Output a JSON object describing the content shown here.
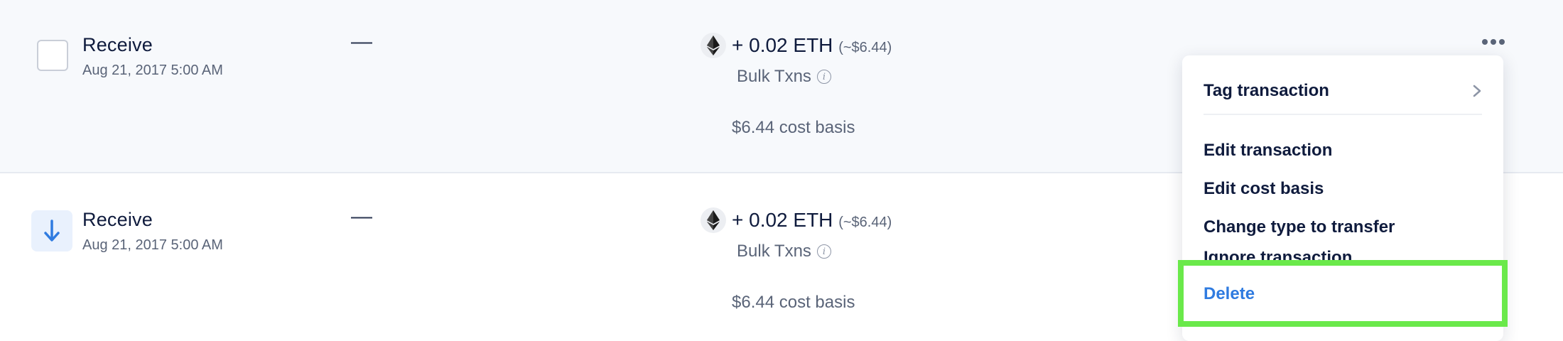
{
  "transactions": [
    {
      "type": "Receive",
      "date": "Aug 21, 2017 5:00 AM",
      "from_value": "—",
      "amount": "+ 0.02 ETH",
      "usd_value": "(~$6.44)",
      "source": "Bulk Txns",
      "cost_basis": "$6.44 cost basis",
      "icon": "checkbox"
    },
    {
      "type": "Receive",
      "date": "Aug 21, 2017 5:00 AM",
      "from_value": "—",
      "amount": "+ 0.02 ETH",
      "usd_value": "(~$6.44)",
      "source": "Bulk Txns",
      "cost_basis": "$6.44 cost basis",
      "icon": "arrow-down-icon"
    }
  ],
  "context_menu": {
    "items": [
      {
        "label": "Tag transaction",
        "has_submenu": true
      },
      {
        "label": "Edit transaction"
      },
      {
        "label": "Edit cost basis"
      },
      {
        "label": "Change type to transfer"
      },
      {
        "label": "Ignore transaction"
      },
      {
        "label": "Delete",
        "style": "danger"
      }
    ]
  },
  "colors": {
    "accent": "#2f7be0",
    "highlight": "#6ae94a",
    "text_primary": "#0f1b3d",
    "text_secondary": "#5a6478"
  }
}
